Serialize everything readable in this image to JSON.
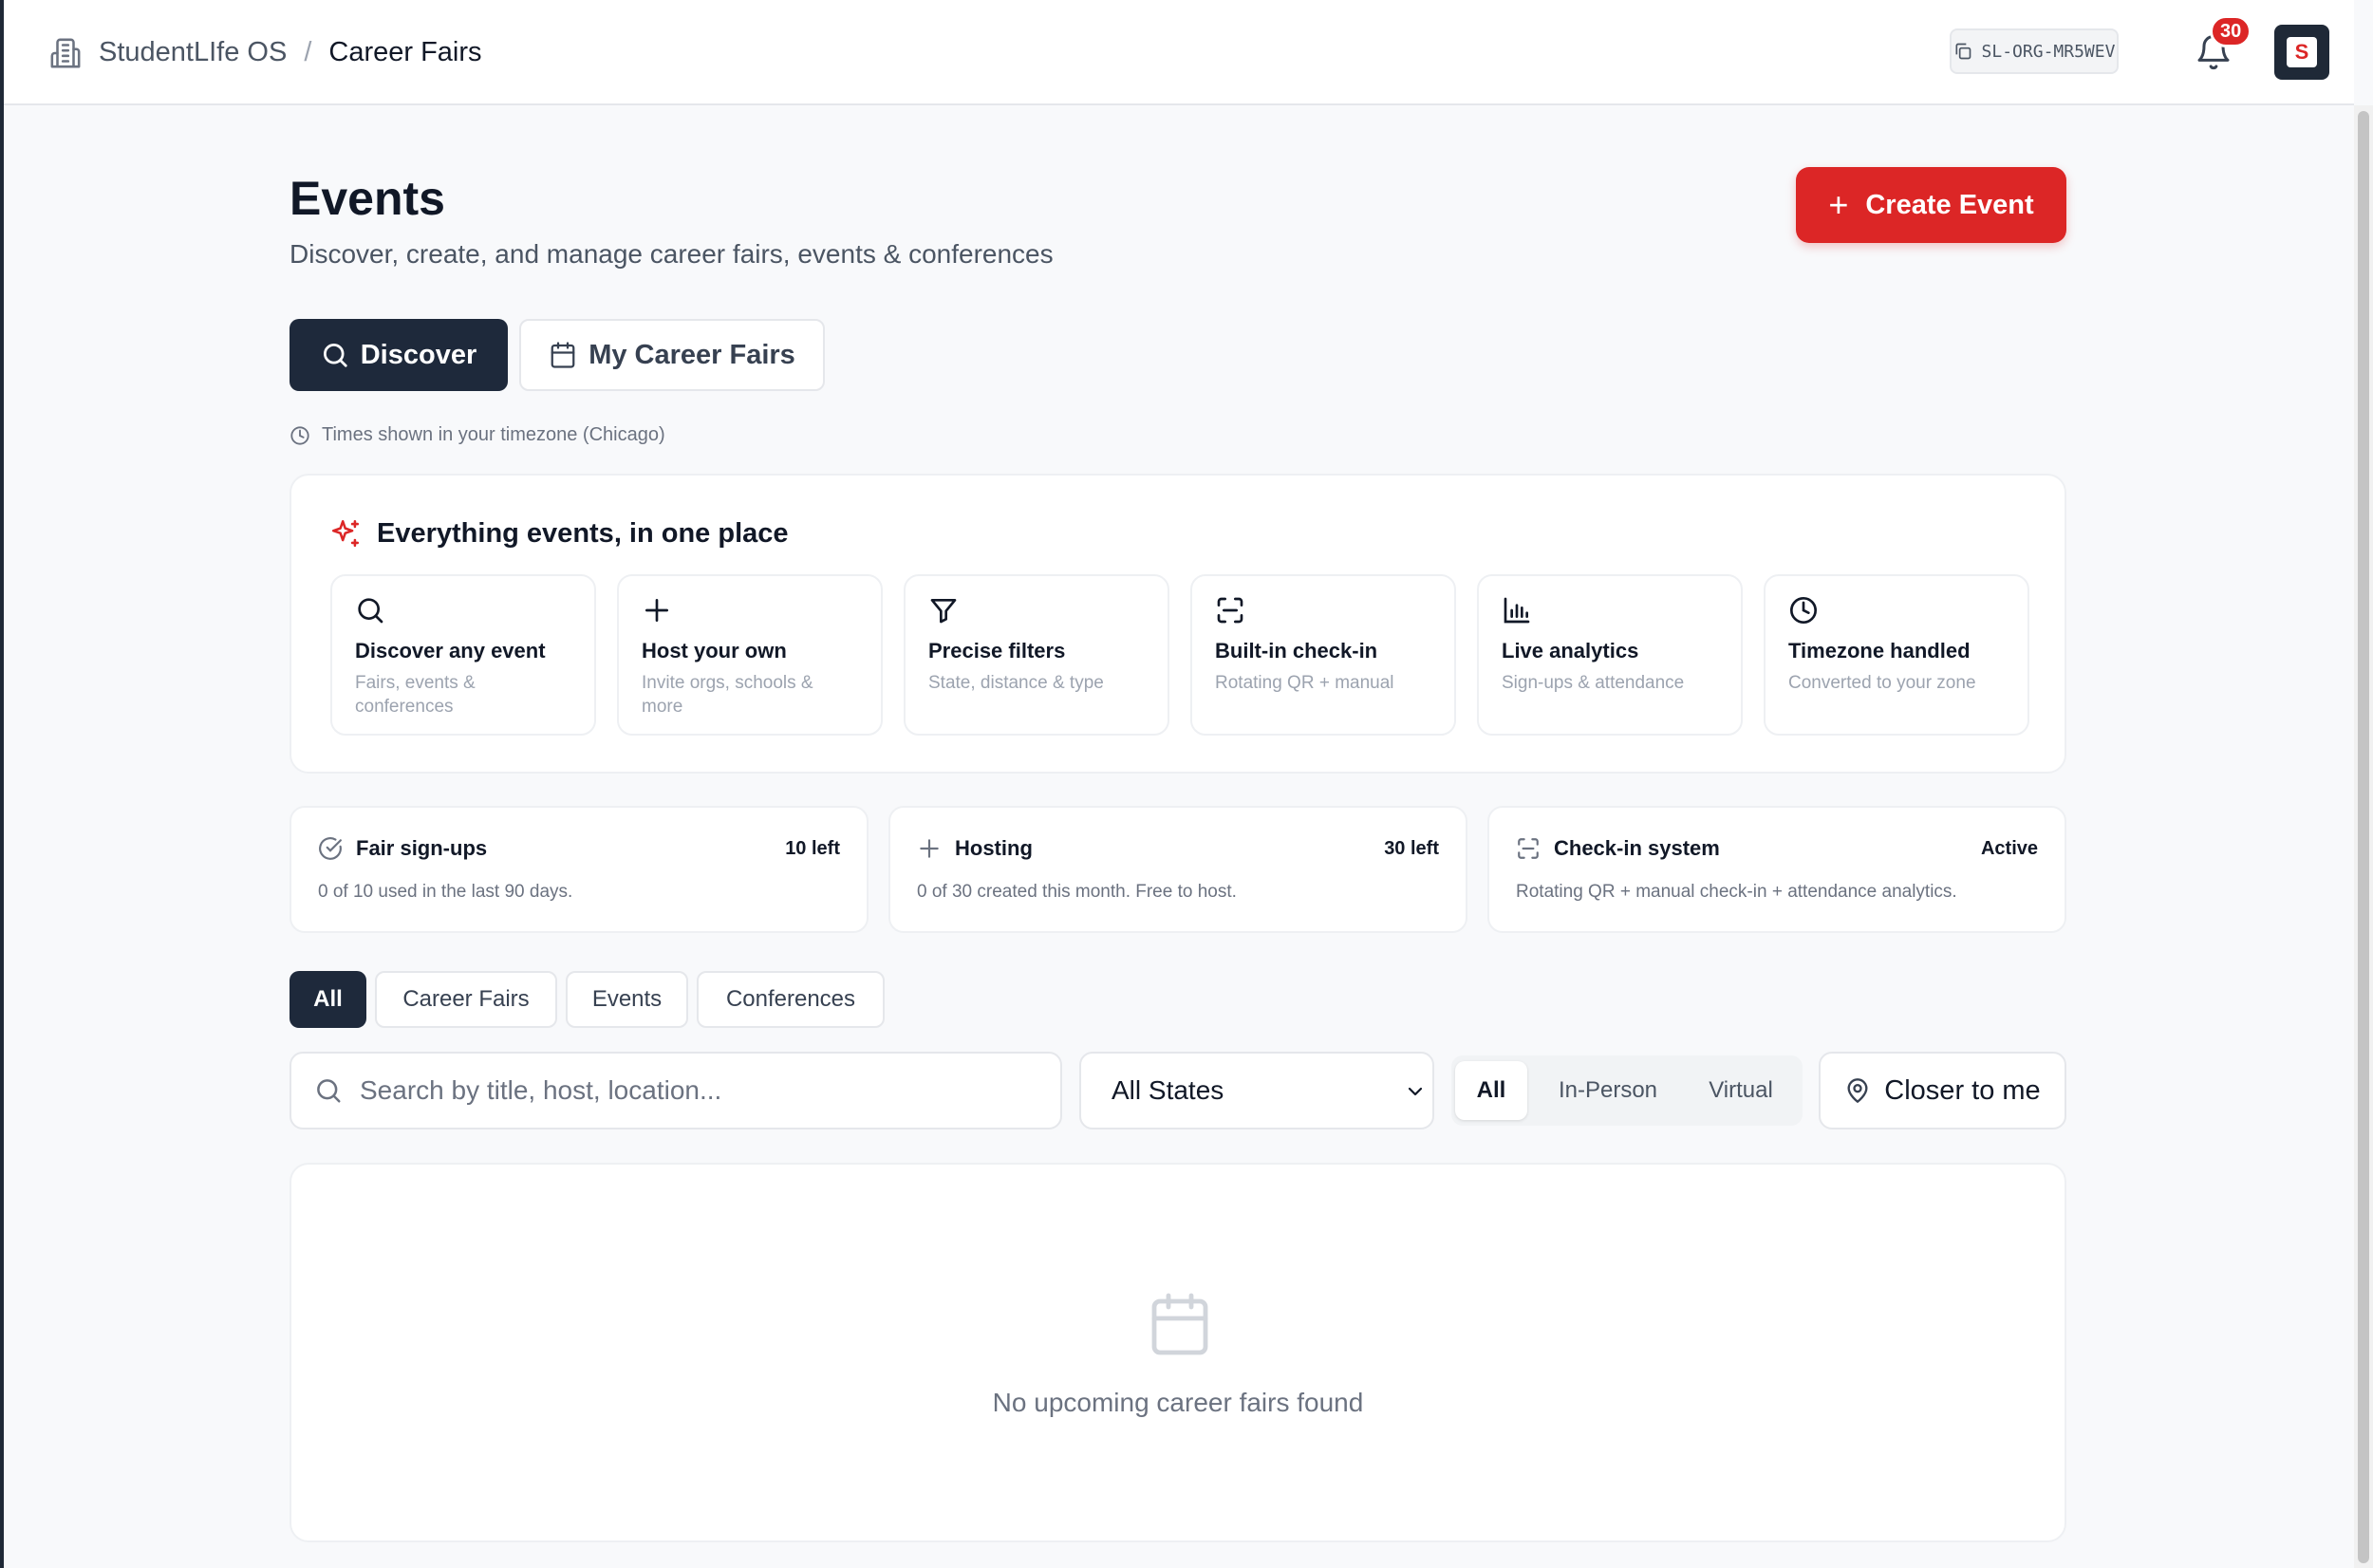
{
  "header": {
    "app_name": "StudentLIfe OS",
    "separator": "/",
    "current_page": "Career Fairs",
    "org_code": "SL-ORG-MR5WEV",
    "notification_count": "30",
    "avatar_letter": "S"
  },
  "page": {
    "title": "Events",
    "subtitle": "Discover, create, and manage career fairs, events & conferences",
    "create_button": "Create Event",
    "timezone_note": "Times shown in your timezone (Chicago)"
  },
  "view_tabs": [
    {
      "label": "Discover",
      "active": true
    },
    {
      "label": "My Career Fairs",
      "active": false
    }
  ],
  "features": {
    "heading": "Everything events, in one place",
    "items": [
      {
        "icon": "search-icon",
        "title": "Discover any event",
        "desc": "Fairs, events & conferences"
      },
      {
        "icon": "plus-icon",
        "title": "Host your own",
        "desc": "Invite orgs, schools & more"
      },
      {
        "icon": "filter-icon",
        "title": "Precise filters",
        "desc": "State, distance & type"
      },
      {
        "icon": "scan-icon",
        "title": "Built-in check-in",
        "desc": "Rotating QR + manual"
      },
      {
        "icon": "bar-chart-icon",
        "title": "Live analytics",
        "desc": "Sign-ups & attendance"
      },
      {
        "icon": "clock-icon",
        "title": "Timezone handled",
        "desc": "Converted to your zone"
      }
    ]
  },
  "stats": [
    {
      "icon": "check-circle-icon",
      "title": "Fair sign-ups",
      "value": "10 left",
      "desc": "0 of 10 used in the last 90 days."
    },
    {
      "icon": "plus-icon",
      "title": "Hosting",
      "value": "30 left",
      "desc": "0 of 30 created this month. Free to host."
    },
    {
      "icon": "scan-icon",
      "title": "Check-in system",
      "value": "Active",
      "desc": "Rotating QR + manual check-in + attendance analytics."
    }
  ],
  "category_tabs": [
    {
      "label": "All",
      "active": true
    },
    {
      "label": "Career Fairs",
      "active": false
    },
    {
      "label": "Events",
      "active": false
    },
    {
      "label": "Conferences",
      "active": false
    }
  ],
  "filters": {
    "search_placeholder": "Search by title, host, location...",
    "search_value": "",
    "state_selected": "All States",
    "mode_options": [
      {
        "label": "All",
        "active": true
      },
      {
        "label": "In-Person",
        "active": false
      },
      {
        "label": "Virtual",
        "active": false
      }
    ],
    "closer_button": "Closer to me"
  },
  "results": {
    "empty_message": "No upcoming career fairs found"
  },
  "colors": {
    "accent": "#dc2626",
    "dark": "#1e293b",
    "background": "#f8f9fb"
  }
}
